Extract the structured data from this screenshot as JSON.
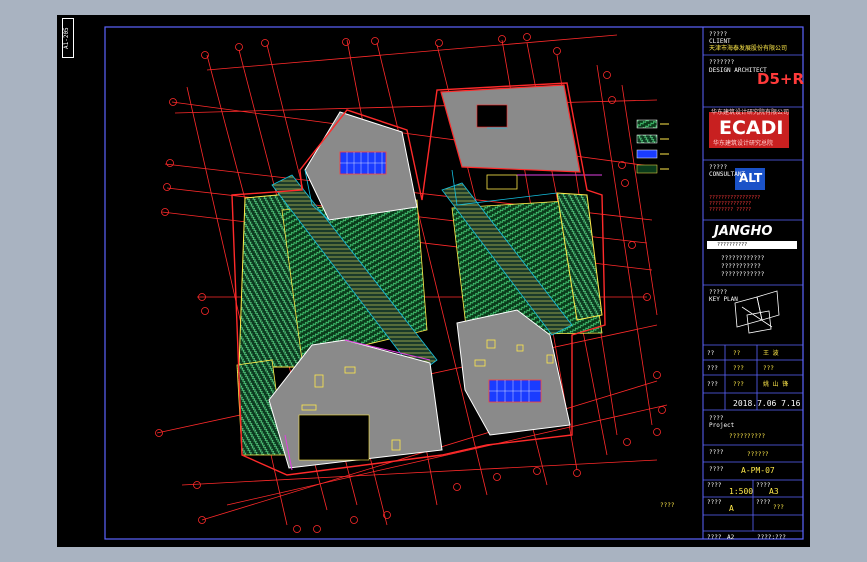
{
  "sheet_tag": "A1-205",
  "side_note": "????",
  "titleblock": {
    "client_caption": "?????",
    "client_en": "CLIENT",
    "client_cn": "天津市海泰发展股份有限公司",
    "architect_caption": "???????",
    "architect_en": "DESIGN ARCHITECT",
    "architect_logo": "D5+R",
    "institute_cn": "华东建筑设计研究院有限公司",
    "institute_logo": "ECADI",
    "institute_sub": "华东建筑设计研究总院",
    "consultant_caption": "?????",
    "consultant_en": "CONSULTANT",
    "consultant_logo": "ALT",
    "consultant_lines": [
      "?????????????????",
      "??????????????",
      "???????? ?????"
    ],
    "contractor_logo": "JANGHO",
    "contractor_band": "??????????",
    "contractor_lines": [
      "????????????",
      "???????????",
      "????????????"
    ],
    "keyplan_caption": "?????",
    "keyplan_en": "KEY PLAN",
    "sign_rows": [
      {
        "label": "??",
        "name": "??",
        "sign": "王 波"
      },
      {
        "label": "???",
        "name": "???",
        "sign": "???"
      },
      {
        "label": "???",
        "name": "???",
        "sign": "姚 山 锋"
      }
    ],
    "date": "2018.7.06 7.16",
    "project_caption": "????",
    "project_en": "Project",
    "project_value": "??????????",
    "drawing_caption": "????",
    "drawing_value": "??????",
    "drawing_no_caption": "????",
    "drawing_no": "A-PM-07",
    "scale_caption": "????",
    "scale": "1:500",
    "size_caption": "????",
    "size": "A3",
    "rev_caption": "????",
    "rev": "A",
    "sheet_caption": "????",
    "sheet_value": "???",
    "footer_left": "????",
    "footer_a": "A2",
    "footer_right": "????:???"
  },
  "colors": {
    "frame": "#a9b3c1",
    "paper": "#000000",
    "grid": "#ff2a2a",
    "building": "#8a8a8a",
    "outline": "#ff2a2a",
    "hatch": "#2f9f63",
    "accent": "#ffe94a",
    "water": "#14c0e0",
    "magenta": "#e040e0",
    "border": "#5c64ff"
  }
}
